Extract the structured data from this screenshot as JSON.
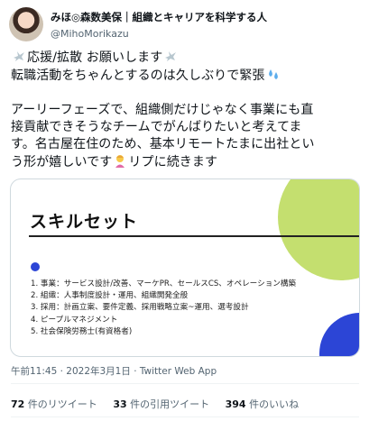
{
  "author": {
    "display_name": "みほ◎森数美保｜組織とキャリアを科学する人",
    "handle": "@MihoMorikazu"
  },
  "tweet": {
    "line1_text": "応援/拡散 お願いします",
    "line2_text": "転職活動をちゃんとするのは久しぶりで緊張",
    "para_lines": [
      "アーリーフェーズで、組織側だけじゃなく事業にも直",
      "接貢献できそうなチームでがんばりたいと考えてま",
      "す。名古屋在住のため、基本リモートたまに出社とい",
      "う形が嬉しいです",
      "リプに続きます"
    ],
    "emoji": {
      "dove": "dove-emoji",
      "sweat": "sweat-droplets-emoji",
      "person": "person-tipping-hand-emoji"
    }
  },
  "card": {
    "title": "スキルセット",
    "items": [
      "1. 事業：サービス設計/改善、マーケPR、セールスCS、オペレーション構築",
      "2. 組織：人事制度設計・運用、組織開発全般",
      "3. 採用：計画立案、要件定義、採用戦略立案~運用、選考設計",
      "4. ピープルマネジメント",
      "5. 社会保険労務士(有資格者)"
    ],
    "colors": {
      "green": "#c4df6f",
      "blue": "#2c45d6"
    }
  },
  "meta": {
    "timestamp": "午前11:45 · 2022年3月1日 · Twitter Web App"
  },
  "stats": {
    "retweets_count": "72",
    "retweets_label": "件のリツイート",
    "quotes_count": "33",
    "quotes_label": "件の引用ツイート",
    "likes_count": "394",
    "likes_label": "件のいいね"
  }
}
